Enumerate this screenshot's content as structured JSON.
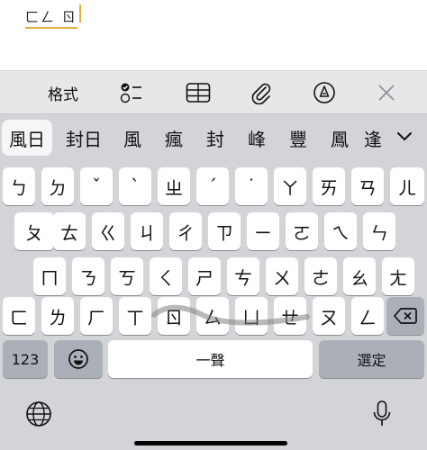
{
  "editor": {
    "composed_text": "ㄈㄥ ㄖ"
  },
  "toolbar": {
    "format_label": "格式",
    "icons": [
      "checklist-icon",
      "table-icon",
      "attachment-icon",
      "markup-icon",
      "close-icon"
    ]
  },
  "candidates": {
    "items": [
      "風日",
      "封日",
      "風",
      "瘋",
      "封",
      "峰",
      "豐",
      "鳳",
      "逢"
    ],
    "expand_icon": "chevron-down-icon"
  },
  "keyboard": {
    "row1": [
      "ㄅ",
      "ㄉ",
      "ˇ",
      "ˋ",
      "ㄓ",
      "ˊ",
      "˙",
      "ㄚ",
      "ㄞ",
      "ㄢ",
      "ㄦ"
    ],
    "row2": [
      "ㄆ",
      "ㄊ",
      "ㄍ",
      "ㄐ",
      "ㄔ",
      "ㄗ",
      "ㄧ",
      "ㄛ",
      "ㄟ",
      "ㄣ"
    ],
    "row3": [
      "ㄇ",
      "ㄋ",
      "ㄎ",
      "ㄑ",
      "ㄕ",
      "ㄘ",
      "ㄨ",
      "ㄜ",
      "ㄠ",
      "ㄤ"
    ],
    "row4": [
      "ㄈ",
      "ㄌ",
      "ㄏ",
      "ㄒ",
      "ㄖ",
      "ㄙ",
      "ㄩ",
      "ㄝ",
      "ㄡ",
      "ㄥ"
    ],
    "numbers_label": "123",
    "space_label": "一聲",
    "select_label": "選定"
  },
  "colors": {
    "keyboard_bg": "#d3d4d8",
    "key_bg": "#ffffff",
    "function_key_bg": "#abb0b8",
    "caret": "#e2b33c"
  }
}
